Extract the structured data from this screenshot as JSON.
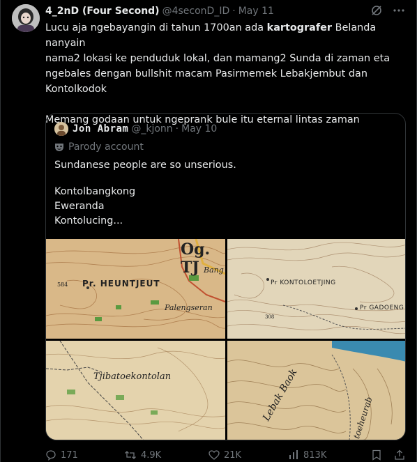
{
  "post": {
    "display_name": "4_2nD (Four Second)",
    "handle": "@4seconD_ID",
    "dot": "·",
    "date": "May 11",
    "text_pre": "Lucu aja ngebayangin di tahun 1700an ada ",
    "text_bold": "kartografer",
    "text_line1_rest": " Belanda nanyain",
    "text_line2": "nama2 lokasi ke penduduk lokal, dan mamang2 Sunda di zaman eta",
    "text_line3": "ngebales dengan bullshit macam Pasirmemek Lebakjembut dan",
    "text_line4": "Kontolkodok",
    "text_line5": "Memang godaan untuk ngeprank bule itu eternal lintas zaman"
  },
  "quote": {
    "display_name": "Jon Abram",
    "handle": "@_kjonn",
    "dot": "·",
    "date": "May 10",
    "parody_label": "Parody account",
    "line1": "Sundanese people are so unserious.",
    "line2": "Kontolbangkong",
    "line3": "Eweranda",
    "line4": "Kontolucing..."
  },
  "maps": {
    "m1_big": "Og. TJ",
    "m1_bang": "Bang",
    "m1_num": "584",
    "m1_place": "Pr. HEUNTJEUT",
    "m1_pal": "Palengseran",
    "m2_place": "Pr KONTOLOETJING",
    "m2_gad": "Pr GADOENG",
    "m2_num": "308",
    "m3_place": "Tjibatoekontolan",
    "m4_lebak": "Lebak Baok",
    "m4_side": "toeheurab"
  },
  "actions": {
    "replies": "171",
    "reposts": "4.9K",
    "likes": "21K",
    "views": "813K"
  },
  "colors": {
    "background": "#000000",
    "text": "#e7e9ea",
    "secondary": "#71767b",
    "border": "#2f3336",
    "map_paper": "#d9c8a2"
  }
}
